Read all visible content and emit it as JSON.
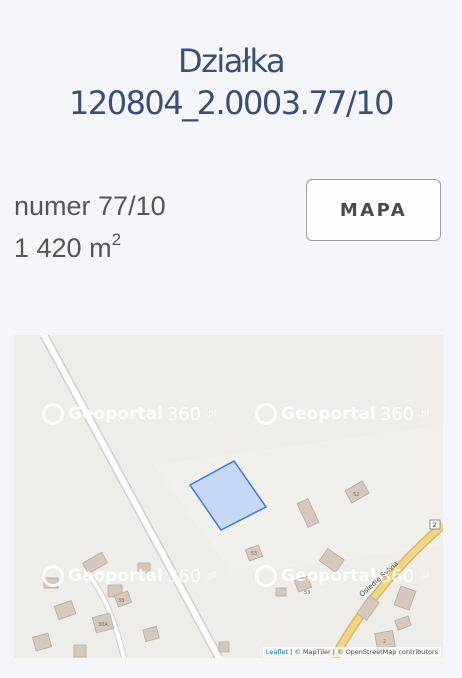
{
  "title": {
    "line1": "Działka",
    "line2": "120804_2.0003.77/10"
  },
  "info": {
    "number": "numer 77/10",
    "area_value": "1 420 m",
    "area_exp": "2"
  },
  "buttons": {
    "map_label": "MAPA"
  },
  "map": {
    "watermark": {
      "brand": "Geoportal",
      "suffix": "360",
      "tld": ".pl"
    },
    "road_label": "Osiedle Sylvia",
    "route_number": "2",
    "house_numbers": [
      "52",
      "53",
      "55",
      "38",
      "38A",
      "2"
    ],
    "attribution": {
      "leaflet": "Leaflet",
      "rest": " | © MapTiler | © OpenStreetMap contributors"
    },
    "colors": {
      "parcel_fill": "#c6d8f5",
      "parcel_stroke": "#3b78e7",
      "building": "#d4c9bc",
      "road_yellow": "#f0d58a",
      "background": "#eeede9"
    }
  }
}
